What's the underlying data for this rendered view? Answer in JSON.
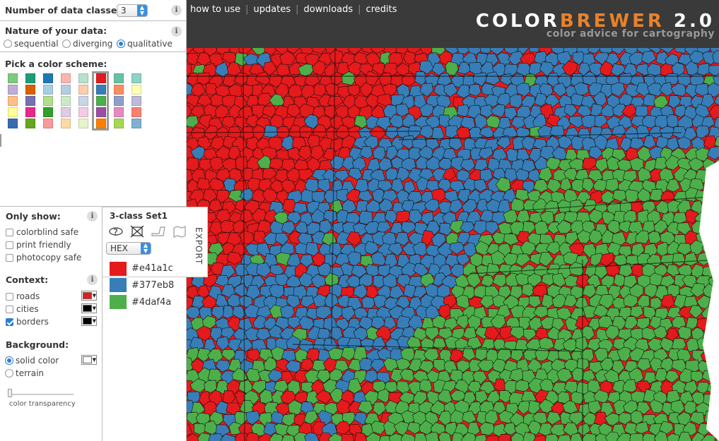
{
  "controls": {
    "num_classes_label": "Number of data classes:",
    "num_classes_value": "3",
    "nature_label": "Nature of your data:",
    "nature_options": [
      "sequential",
      "diverging",
      "qualitative"
    ],
    "pick_scheme_label": "Pick a color scheme:",
    "only_show_label": "Only show:",
    "only_show_options": [
      "colorblind safe",
      "print friendly",
      "photocopy safe"
    ],
    "context_label": "Context:",
    "context_options": [
      "roads",
      "cities",
      "borders"
    ],
    "background_label": "Background:",
    "background_options": [
      "solid color",
      "terrain"
    ],
    "transparency_label": "color transparency",
    "info_glyph": "i"
  },
  "schemes": [
    {
      "colors": [
        "#7fc97f",
        "#beaed4",
        "#fdc086",
        "#ffff99",
        "#386cb0"
      ]
    },
    {
      "colors": [
        "#1b9e77",
        "#d95f02",
        "#7570b3",
        "#e7298a",
        "#66a61e"
      ]
    },
    {
      "colors": [
        "#1f78b4",
        "#a6cee3",
        "#b2df8a",
        "#33a02c",
        "#fb9a99"
      ]
    },
    {
      "colors": [
        "#fbb4ae",
        "#b3cde3",
        "#ccebc5",
        "#decbe4",
        "#fed9a6"
      ]
    },
    {
      "colors": [
        "#b3e2cd",
        "#fdcdac",
        "#cbd5e8",
        "#f4cae4",
        "#e6f5c9"
      ]
    },
    {
      "colors": [
        "#e41a1c",
        "#377eb8",
        "#4daf4a",
        "#984ea3",
        "#ff7f00"
      ]
    },
    {
      "colors": [
        "#66c2a5",
        "#fc8d62",
        "#8da0cb",
        "#e78ac3",
        "#a6d854"
      ]
    },
    {
      "colors": [
        "#8dd3c7",
        "#ffffb3",
        "#bebada",
        "#fb8072",
        "#80b1d3"
      ]
    }
  ],
  "export": {
    "title": "3-class Set1",
    "format": "HEX",
    "tab_label": "EXPORT",
    "legend": [
      {
        "color": "#e41a1c",
        "hex": "#e41a1c"
      },
      {
        "color": "#377eb8",
        "hex": "#377eb8"
      },
      {
        "color": "#4daf4a",
        "hex": "#4daf4a"
      }
    ]
  },
  "nav": {
    "links": [
      "how to use",
      "updates",
      "downloads",
      "credits"
    ]
  },
  "brand": {
    "title_part1": "COLOR",
    "title_part2": "BREWER",
    "title_part3": " 2.0",
    "subtitle": "color advice for cartography"
  },
  "colors": {
    "accent": "#2a7fd4",
    "red": "#e41a1c",
    "blue": "#377eb8",
    "green": "#4daf4a",
    "topbar": "#3a3a3a"
  }
}
